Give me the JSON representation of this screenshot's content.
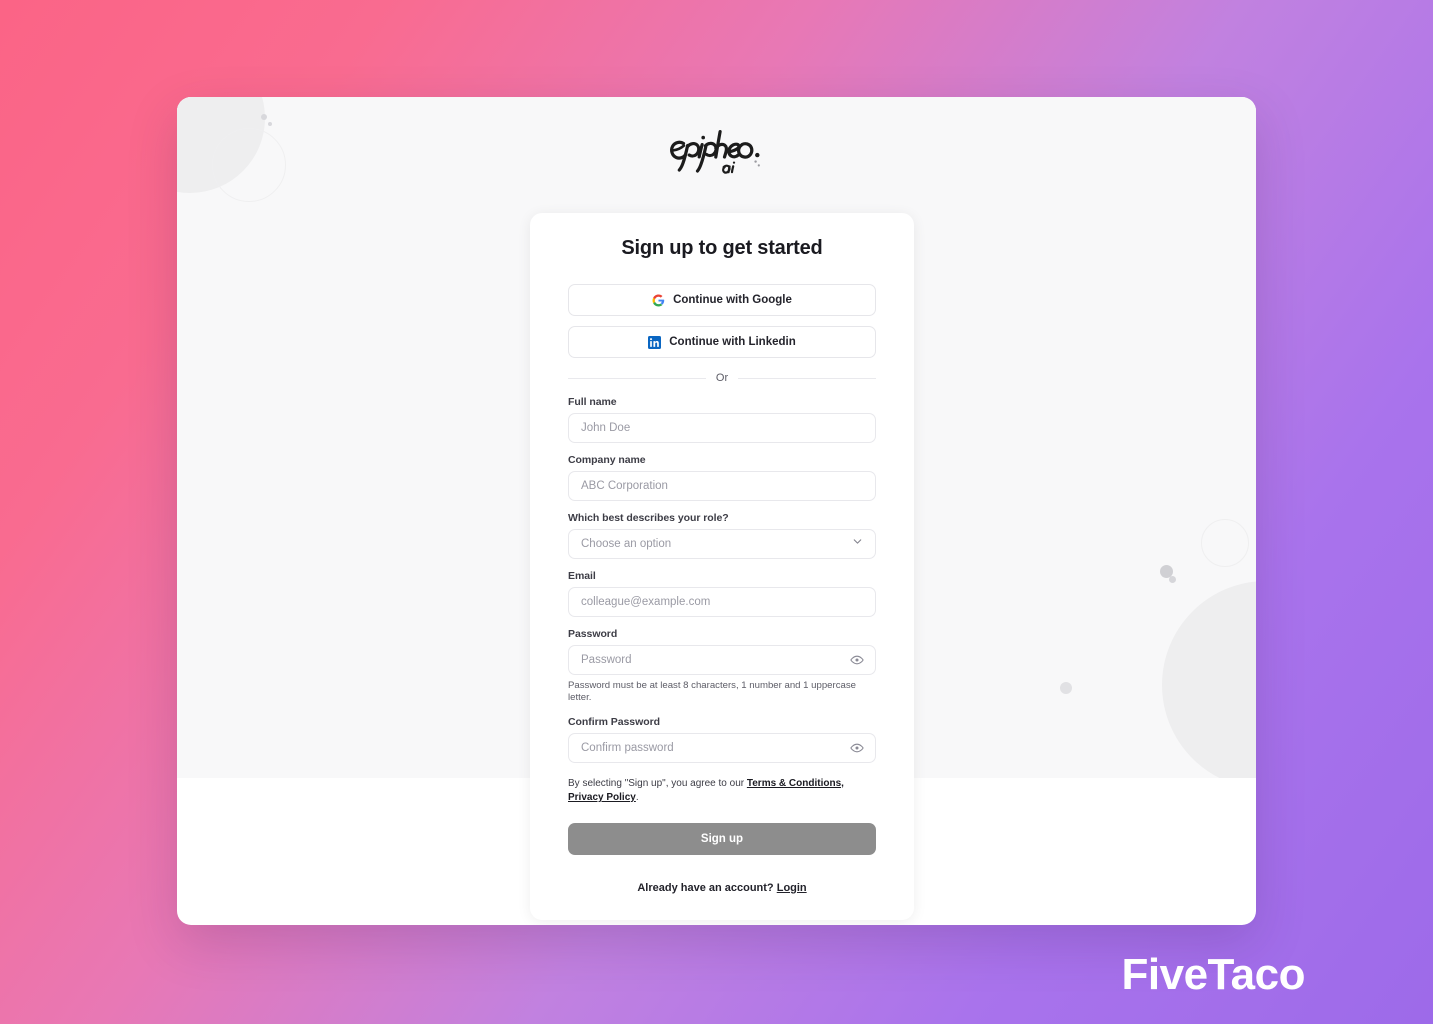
{
  "brand": {
    "logo_name": "Epipheo",
    "logo_sub": "ai"
  },
  "watermark": {
    "text": "FiveTaco"
  },
  "card": {
    "title": "Sign up to get started",
    "oauth": [
      {
        "label": "Continue with Google",
        "icon": "google-icon"
      },
      {
        "label": "Continue with Linkedin",
        "icon": "linkedin-icon"
      }
    ],
    "divider_label": "Or",
    "fields": [
      {
        "label": "Full name",
        "placeholder": "John Doe",
        "value": ""
      },
      {
        "label": "Company name",
        "placeholder": "ABC Corporation",
        "value": ""
      },
      {
        "label": "Which best describes your role?",
        "placeholder": "Choose an option",
        "value": ""
      },
      {
        "label": "Email",
        "placeholder": "colleague@example.com",
        "value": ""
      },
      {
        "label": "Password",
        "placeholder": "Password",
        "value": ""
      },
      {
        "label": "Confirm Password",
        "placeholder": "Confirm password",
        "value": ""
      }
    ],
    "password_hint": "Password must be at least 8 characters, 1 number and 1 uppercase letter.",
    "terms": {
      "prefix": "By selecting \"Sign up\", you agree to our ",
      "link_terms": "Terms & Conditions,",
      "link_privacy": "Privacy Policy",
      "suffix": "."
    },
    "submit_label": "Sign up",
    "login_prompt": "Already have an account? ",
    "login_link": "Login"
  },
  "colors": {
    "gradient_start": "#fb6486",
    "gradient_end": "#9d6ae9",
    "submit_bg": "#8d8d8d",
    "google_blue": "#4285f4",
    "linkedin_blue": "#0a66c2"
  }
}
